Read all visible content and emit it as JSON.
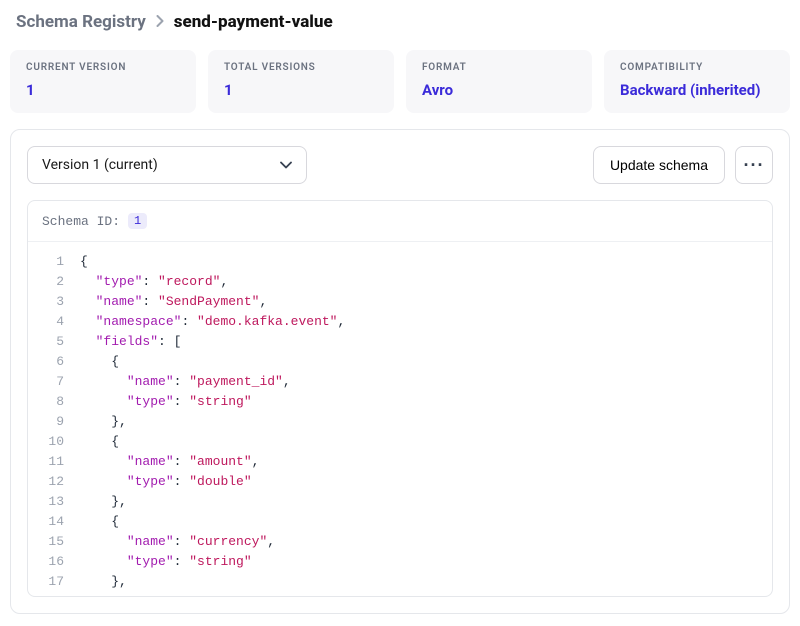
{
  "breadcrumb": {
    "root": "Schema Registry",
    "leaf": "send-payment-value"
  },
  "stats": {
    "current_version": {
      "label": "CURRENT VERSION",
      "value": "1"
    },
    "total_versions": {
      "label": "TOTAL VERSIONS",
      "value": "1"
    },
    "format": {
      "label": "FORMAT",
      "value": "Avro"
    },
    "compatibility": {
      "label": "COMPATIBILITY",
      "value": "Backward (inherited)"
    }
  },
  "toolbar": {
    "version_selected": "Version 1 (current)",
    "update_label": "Update schema"
  },
  "schema_header": {
    "label": "Schema ID:",
    "id": "1"
  },
  "code": {
    "lines": [
      {
        "n": "1",
        "t": [
          [
            "brk",
            "{"
          ]
        ]
      },
      {
        "n": "2",
        "t": [
          [
            "brk",
            "  "
          ],
          [
            "key",
            "\"type\""
          ],
          [
            "brk",
            ": "
          ],
          [
            "str",
            "\"record\""
          ],
          [
            "brk",
            ","
          ]
        ]
      },
      {
        "n": "3",
        "t": [
          [
            "brk",
            "  "
          ],
          [
            "key",
            "\"name\""
          ],
          [
            "brk",
            ": "
          ],
          [
            "str",
            "\"SendPayment\""
          ],
          [
            "brk",
            ","
          ]
        ]
      },
      {
        "n": "4",
        "t": [
          [
            "brk",
            "  "
          ],
          [
            "key",
            "\"namespace\""
          ],
          [
            "brk",
            ": "
          ],
          [
            "str",
            "\"demo.kafka.event\""
          ],
          [
            "brk",
            ","
          ]
        ]
      },
      {
        "n": "5",
        "t": [
          [
            "brk",
            "  "
          ],
          [
            "key",
            "\"fields\""
          ],
          [
            "brk",
            ": ["
          ]
        ]
      },
      {
        "n": "6",
        "t": [
          [
            "brk",
            "    {"
          ]
        ]
      },
      {
        "n": "7",
        "t": [
          [
            "brk",
            "      "
          ],
          [
            "key",
            "\"name\""
          ],
          [
            "brk",
            ": "
          ],
          [
            "str",
            "\"payment_id\""
          ],
          [
            "brk",
            ","
          ]
        ]
      },
      {
        "n": "8",
        "t": [
          [
            "brk",
            "      "
          ],
          [
            "key",
            "\"type\""
          ],
          [
            "brk",
            ": "
          ],
          [
            "str",
            "\"string\""
          ]
        ]
      },
      {
        "n": "9",
        "t": [
          [
            "brk",
            "    },"
          ]
        ]
      },
      {
        "n": "10",
        "t": [
          [
            "brk",
            "    {"
          ]
        ]
      },
      {
        "n": "11",
        "t": [
          [
            "brk",
            "      "
          ],
          [
            "key",
            "\"name\""
          ],
          [
            "brk",
            ": "
          ],
          [
            "str",
            "\"amount\""
          ],
          [
            "brk",
            ","
          ]
        ]
      },
      {
        "n": "12",
        "t": [
          [
            "brk",
            "      "
          ],
          [
            "key",
            "\"type\""
          ],
          [
            "brk",
            ": "
          ],
          [
            "str",
            "\"double\""
          ]
        ]
      },
      {
        "n": "13",
        "t": [
          [
            "brk",
            "    },"
          ]
        ]
      },
      {
        "n": "14",
        "t": [
          [
            "brk",
            "    {"
          ]
        ]
      },
      {
        "n": "15",
        "t": [
          [
            "brk",
            "      "
          ],
          [
            "key",
            "\"name\""
          ],
          [
            "brk",
            ": "
          ],
          [
            "str",
            "\"currency\""
          ],
          [
            "brk",
            ","
          ]
        ]
      },
      {
        "n": "16",
        "t": [
          [
            "brk",
            "      "
          ],
          [
            "key",
            "\"type\""
          ],
          [
            "brk",
            ": "
          ],
          [
            "str",
            "\"string\""
          ]
        ]
      },
      {
        "n": "17",
        "t": [
          [
            "brk",
            "    },"
          ]
        ]
      }
    ]
  }
}
